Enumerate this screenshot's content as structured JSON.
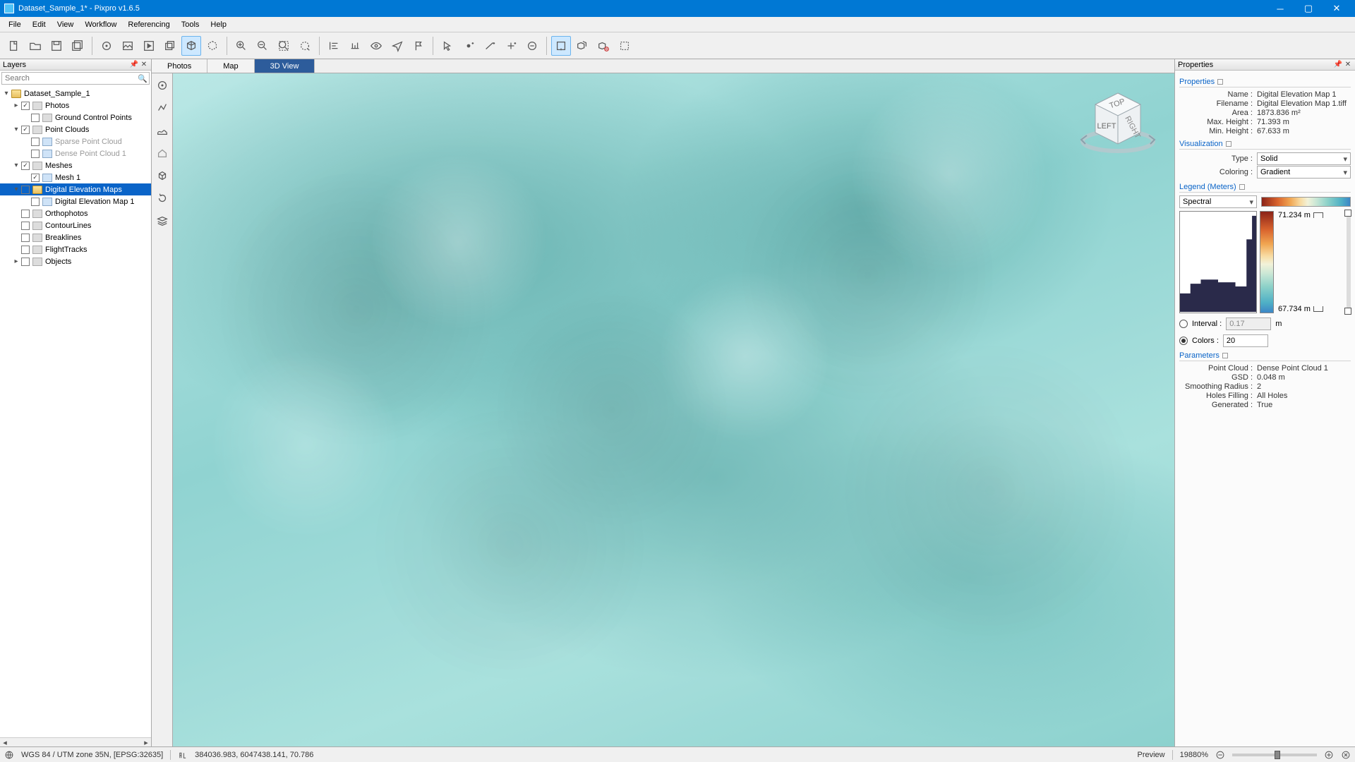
{
  "title": "Dataset_Sample_1* - Pixpro v1.6.5",
  "menu": [
    "File",
    "Edit",
    "View",
    "Workflow",
    "Referencing",
    "Tools",
    "Help"
  ],
  "layers": {
    "panel_title": "Layers",
    "search_placeholder": "Search",
    "root": "Dataset_Sample_1",
    "items": [
      {
        "label": "Photos",
        "depth": 1,
        "chk": true,
        "tog": "▸",
        "folder": true
      },
      {
        "label": "Ground Control Points",
        "depth": 2,
        "chk": false,
        "folder": true
      },
      {
        "label": "Point Clouds",
        "depth": 1,
        "chk": true,
        "tog": "▾",
        "folder": true
      },
      {
        "label": "Sparse Point Cloud",
        "depth": 2,
        "chk": false,
        "item": true,
        "gray": true
      },
      {
        "label": "Dense Point Cloud 1",
        "depth": 2,
        "chk": false,
        "item": true,
        "gray": true
      },
      {
        "label": "Meshes",
        "depth": 1,
        "chk": true,
        "tog": "▾",
        "folder": true
      },
      {
        "label": "Mesh 1",
        "depth": 2,
        "chk": true,
        "item": true
      },
      {
        "label": "Digital Elevation Maps",
        "depth": 1,
        "chk": false,
        "tog": "▾",
        "folder": true,
        "sel": true
      },
      {
        "label": "Digital Elevation Map 1",
        "depth": 2,
        "chk": false,
        "item": true
      },
      {
        "label": "Orthophotos",
        "depth": 1,
        "chk": false,
        "folder": true
      },
      {
        "label": "ContourLines",
        "depth": 1,
        "chk": false,
        "folder": true
      },
      {
        "label": "Breaklines",
        "depth": 1,
        "chk": false,
        "folder": true
      },
      {
        "label": "FlightTracks",
        "depth": 1,
        "chk": false,
        "folder": true
      },
      {
        "label": "Objects",
        "depth": 1,
        "chk": false,
        "tog": "▸",
        "folder": true
      }
    ]
  },
  "tabs": [
    "Photos",
    "Map",
    "3D View"
  ],
  "active_tab": 2,
  "navcube": {
    "top": "TOP",
    "left": "LEFT",
    "right": "RIGHT"
  },
  "props": {
    "panel_title": "Properties",
    "sections": {
      "properties": "Properties",
      "visualization": "Visualization",
      "legend": "Legend (Meters)",
      "parameters": "Parameters"
    },
    "properties": [
      {
        "k": "Name :",
        "v": "Digital Elevation Map 1"
      },
      {
        "k": "Filename :",
        "v": "Digital Elevation Map 1.tiff"
      },
      {
        "k": "Area :",
        "v": "1873.836 m²"
      },
      {
        "k": "Max. Height :",
        "v": "71.393 m"
      },
      {
        "k": "Min. Height :",
        "v": "67.633 m"
      }
    ],
    "vis": {
      "type_label": "Type :",
      "type": "Solid",
      "coloring_label": "Coloring :",
      "coloring": "Gradient"
    },
    "legend": {
      "scheme": "Spectral",
      "max": "71.234 m",
      "min": "67.734 m",
      "interval_label": "Interval :",
      "interval": "0.17",
      "interval_unit": "m",
      "colors_label": "Colors :",
      "colors": "20"
    },
    "params": [
      {
        "k": "Point Cloud :",
        "v": "Dense Point Cloud 1"
      },
      {
        "k": "GSD :",
        "v": "0.048 m"
      },
      {
        "k": "Smoothing Radius :",
        "v": "2"
      },
      {
        "k": "Holes Filling :",
        "v": "All Holes"
      },
      {
        "k": "Generated :",
        "v": "True"
      }
    ]
  },
  "status": {
    "crs": "WGS 84 / UTM zone 35N, [EPSG:32635]",
    "coords": "384036.983, 6047438.141, 70.786",
    "preview": "Preview",
    "zoom": "19880%"
  }
}
